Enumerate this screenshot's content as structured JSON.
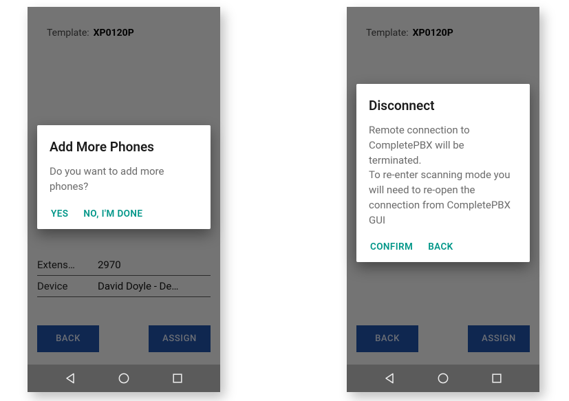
{
  "left": {
    "template_label": "Template:",
    "template_value": "XP0120P",
    "extension_label": "Extens…",
    "extension_value": "2970",
    "device_label": "Device",
    "device_value": "David Doyle - De…",
    "back_btn": "BACK",
    "assign_btn": "ASSIGN",
    "dialog": {
      "title": "Add More Phones",
      "body": "Do you want to add more phones?",
      "yes": "YES",
      "no": "NO, I'M DONE"
    }
  },
  "right": {
    "template_label": "Template:",
    "template_value": "XP0120P",
    "back_btn": "BACK",
    "assign_btn": "ASSIGN",
    "dialog": {
      "title": "Disconnect",
      "body": "Remote connection to CompletePBX will be terminated.\nTo re-enter scanning mode you will need to re-open the connection from CompletePBX GUI",
      "confirm": "CONFIRM",
      "back": "BACK"
    }
  }
}
